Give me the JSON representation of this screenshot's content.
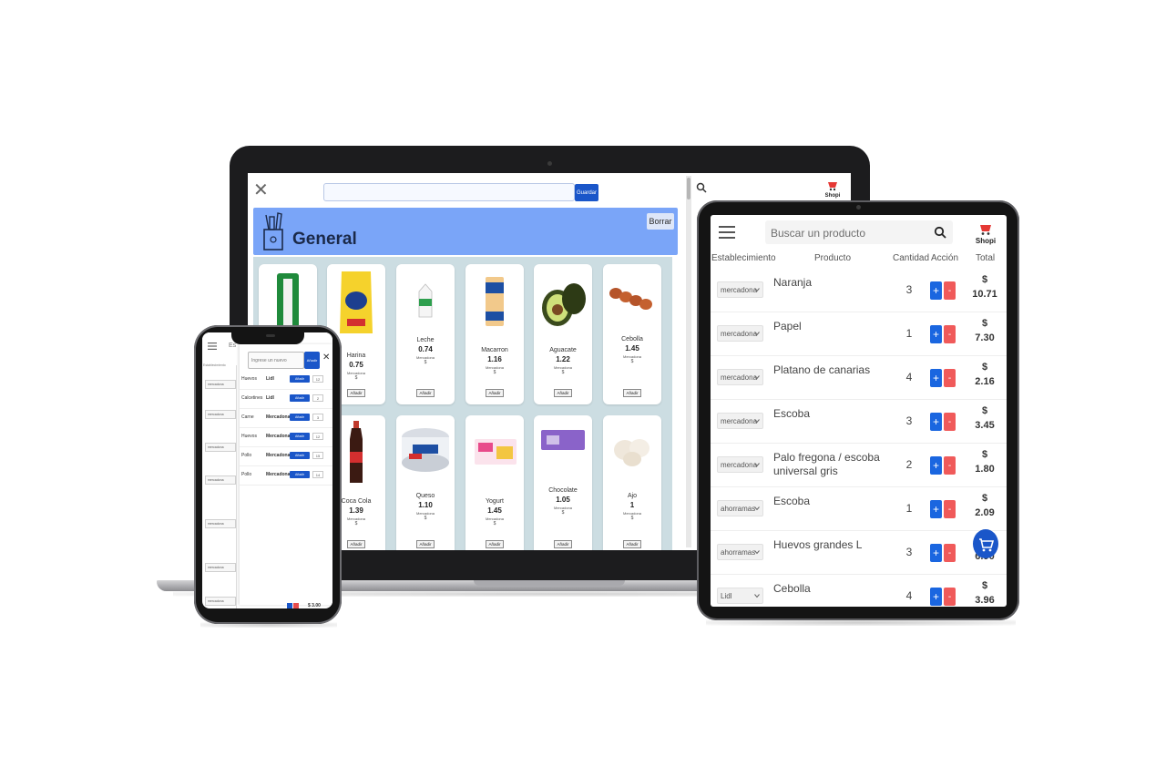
{
  "laptop": {
    "save_label": "Guardar",
    "list_title": "General",
    "clear_label": "Borrar",
    "products": [
      {
        "name": "",
        "price": "",
        "store": "",
        "currency": ""
      },
      {
        "name": "Harina",
        "price": "0.75",
        "store": "Mercadona",
        "currency": "$"
      },
      {
        "name": "Leche",
        "price": "0.74",
        "store": "Mercadona",
        "currency": "$"
      },
      {
        "name": "Macarron",
        "price": "1.16",
        "store": "Mercadona",
        "currency": "$"
      },
      {
        "name": "Aguacate",
        "price": "1.22",
        "store": "Mercadona",
        "currency": "$"
      },
      {
        "name": "Cebolla",
        "price": "1.45",
        "store": "Mercadona",
        "currency": "$"
      },
      {
        "name": "",
        "price": "",
        "store": "",
        "currency": ""
      },
      {
        "name": "Coca Cola",
        "price": "1.39",
        "store": "Mercadona",
        "currency": "$"
      },
      {
        "name": "Queso",
        "price": "1.10",
        "store": "Mercadona",
        "currency": "$"
      },
      {
        "name": "Yogurt",
        "price": "1.45",
        "store": "Mercadona",
        "currency": "$"
      },
      {
        "name": "Chocolate",
        "price": "1.05",
        "store": "Mercadona",
        "currency": "$"
      },
      {
        "name": "Ajo",
        "price": "1",
        "store": "Mercadona",
        "currency": "$"
      }
    ],
    "add_label": "Añadir"
  },
  "phone": {
    "menu_text": "Es",
    "column_label": "Establecimiento",
    "input_placeholder": "Ingrese un nuevo",
    "add_label": "Añadir",
    "select_value": "mercadona",
    "rows": [
      {
        "product": "Huevos",
        "store": "Lidl",
        "qty": "12"
      },
      {
        "product": "Calcetines",
        "store": "Lidl",
        "qty": "2"
      },
      {
        "product": "Carne",
        "store": "Mercadona",
        "qty": "3"
      },
      {
        "product": "Huevos",
        "store": "Mercadona",
        "qty": "12"
      },
      {
        "product": "Pollo",
        "store": "Mercadona",
        "qty": "15"
      },
      {
        "product": "Pollo",
        "store": "Mercadona",
        "qty": "14"
      }
    ],
    "total": "$ 3.00"
  },
  "tablet": {
    "search_placeholder": "Buscar un producto",
    "headers": {
      "store": "Establecimiento",
      "product": "Producto",
      "qty": "Cantidad",
      "action": "Acción",
      "total": "Total"
    },
    "currency": "$",
    "rows": [
      {
        "store": "mercadona",
        "product": "Naranja",
        "qty": "3",
        "total": "10.71"
      },
      {
        "store": "mercadona",
        "product": "Papel",
        "qty": "1",
        "total": "7.30"
      },
      {
        "store": "mercadona",
        "product": "Platano de canarias",
        "qty": "4",
        "total": "2.16"
      },
      {
        "store": "mercadona",
        "product": "Escoba",
        "qty": "3",
        "total": "3.45"
      },
      {
        "store": "mercadona",
        "product": "Palo fregona / escoba universal gris",
        "qty": "2",
        "total": "1.80"
      },
      {
        "store": "ahorramas",
        "product": "Escoba",
        "qty": "1",
        "total": "2.09"
      },
      {
        "store": "ahorramas",
        "product": "Huevos grandes L",
        "qty": "3",
        "total": "6.90"
      },
      {
        "store": "Lidl",
        "product": "Cebolla",
        "qty": "4",
        "total": "3.96"
      }
    ]
  },
  "brand": {
    "name": "Shopi"
  },
  "colors": {
    "primary_blue": "#1a56c9",
    "banner_blue": "#7aa5f8",
    "minus_red": "#f05a5a",
    "grid_bg": "#ccdde2"
  }
}
